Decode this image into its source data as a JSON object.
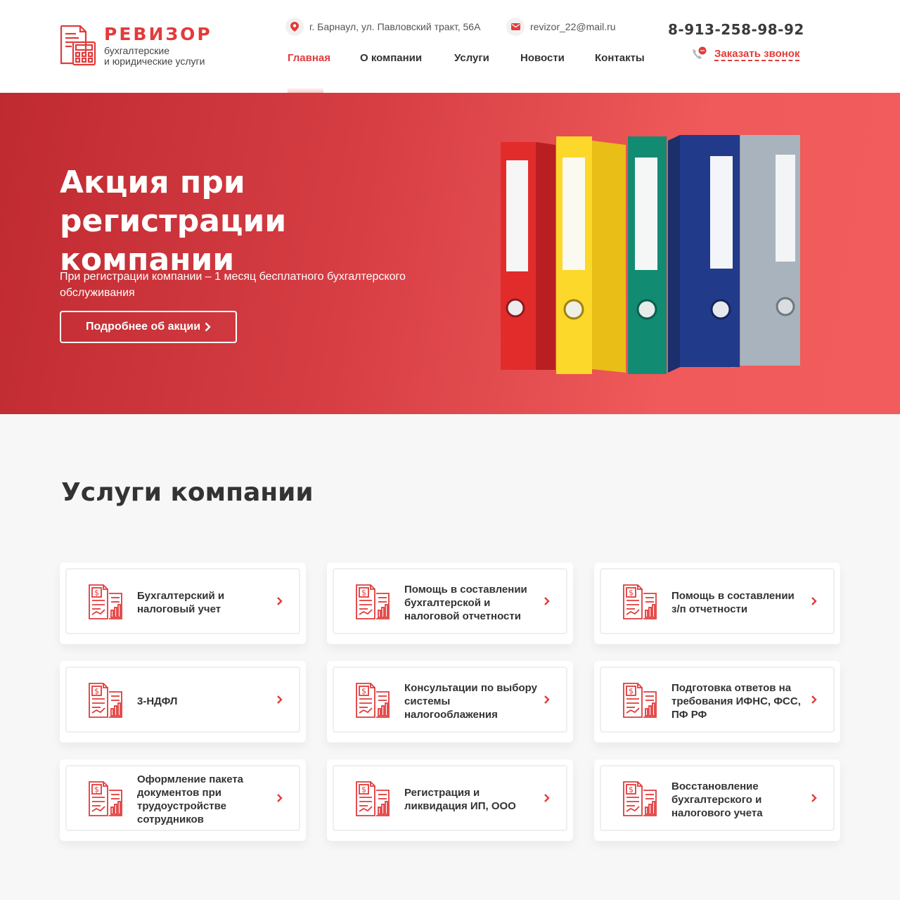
{
  "brand": {
    "name": "РЕВИЗОР",
    "tagline_line1": "бухгалтерские",
    "tagline_line2": "и юридические услуги",
    "accent_color": "#e23b3b"
  },
  "header": {
    "address": "г. Барнаул, ул. Павловский тракт, 56А",
    "email": "revizor_22@mail.ru",
    "phone": "8-913-258-98-92",
    "callback_label": "Заказать звонок",
    "icons": {
      "address": "map-pin-icon",
      "email": "envelope-icon",
      "callback": "phone-chat-icon"
    }
  },
  "nav": {
    "items": [
      {
        "label": "Главная",
        "active": true
      },
      {
        "label": "О компании",
        "active": false
      },
      {
        "label": "Услуги",
        "active": false
      },
      {
        "label": "Новости",
        "active": false
      },
      {
        "label": "Контакты",
        "active": false
      }
    ]
  },
  "hero": {
    "title_line1": "Акция при регистрации",
    "title_line2": "компании",
    "text": "При регистрации компании – 1 месяц бесплатного бухгалтерского обслуживания",
    "button_label": "Подробнее об акции",
    "gradient": [
      "#bf2a30",
      "#f25c5c"
    ]
  },
  "services": {
    "title": "Услуги компании",
    "cards": [
      {
        "label": "Бухгалтерский и налоговый учет"
      },
      {
        "label": "Помощь в составлении бухгалтерской и налоговой отчетности"
      },
      {
        "label": "Помощь в составлении з/п отчетности"
      },
      {
        "label": "3-НДФЛ"
      },
      {
        "label": "Консультации по выбору системы налогооблажения"
      },
      {
        "label": "Подготовка ответов на требования ИФНС, ФСС, ПФ РФ"
      },
      {
        "label": "Оформление пакета документов при трудоустройстве сотрудников"
      },
      {
        "label": "Регистрация и ликвидация ИП, ООО"
      },
      {
        "label": "Восстановление бухгалтерского и налогового учета"
      }
    ]
  }
}
